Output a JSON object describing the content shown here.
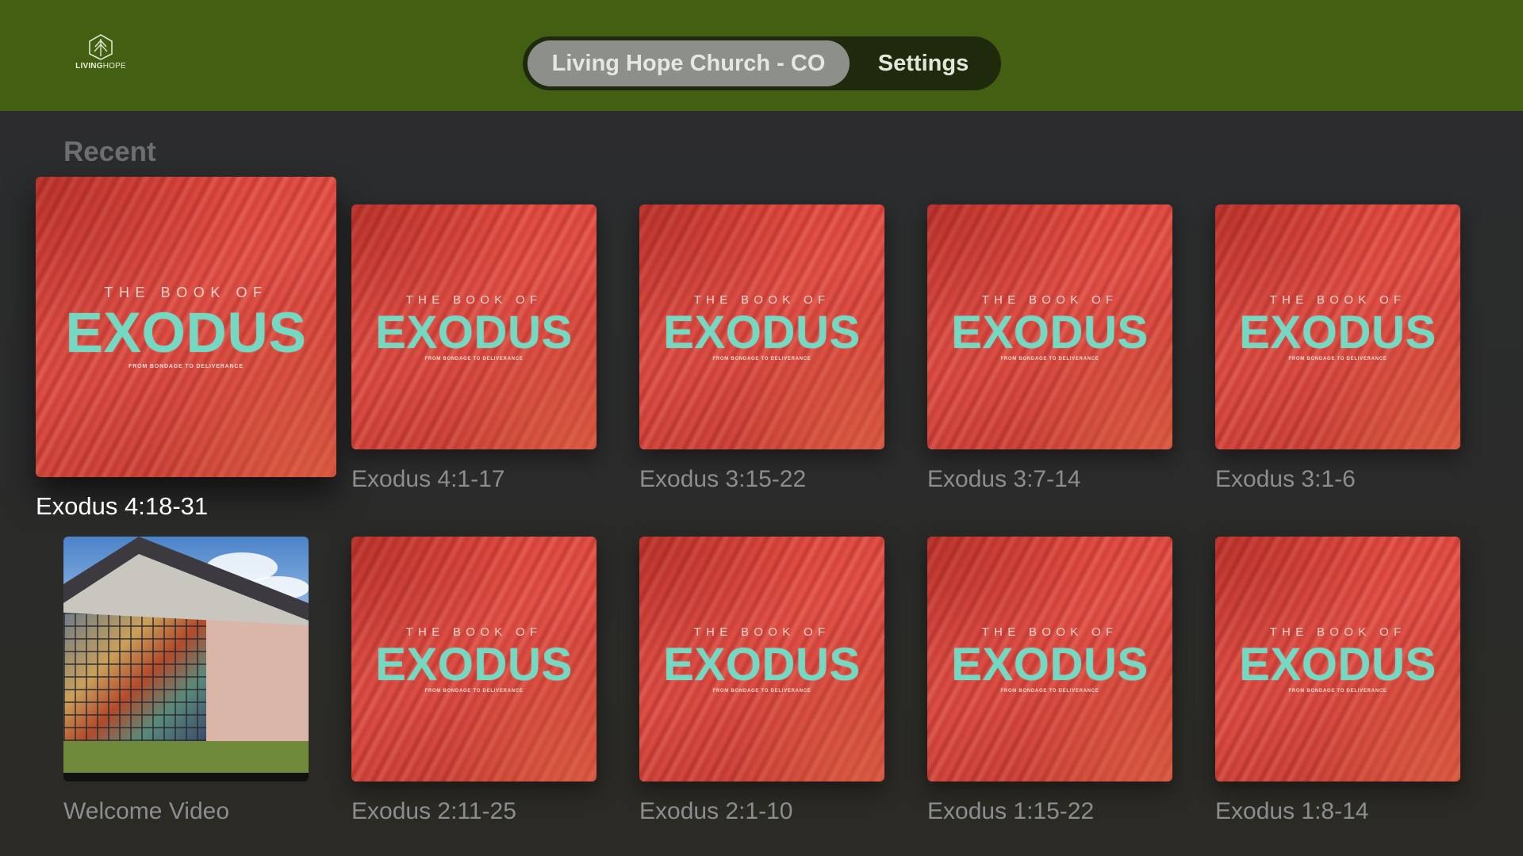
{
  "header": {
    "logo_text_bold": "LIVING",
    "logo_text_light": "HOPE",
    "tabs": [
      {
        "label": "Living Hope Church - CO",
        "selected": true
      },
      {
        "label": "Settings",
        "selected": false
      }
    ],
    "colors": {
      "bar": "#435f12",
      "tab_selected_bg": "#8d8f8a"
    }
  },
  "section": {
    "title": "Recent"
  },
  "artwork": {
    "top_line": "THE BOOK OF",
    "main": "EXODUS",
    "sub": "FROM BONDAGE TO DELIVERANCE"
  },
  "items": [
    {
      "title": "Exodus 4:18-31",
      "focused": true
    },
    {
      "title": "Exodus 4:1-17"
    },
    {
      "title": "Exodus 3:15-22"
    },
    {
      "title": "Exodus 3:7-14"
    },
    {
      "title": "Exodus 3:1-6"
    },
    {
      "title": "Welcome Video"
    },
    {
      "title": "Exodus 2:11-25"
    },
    {
      "title": "Exodus 2:1-10"
    },
    {
      "title": "Exodus 1:15-22"
    },
    {
      "title": "Exodus 1:8-14"
    }
  ]
}
